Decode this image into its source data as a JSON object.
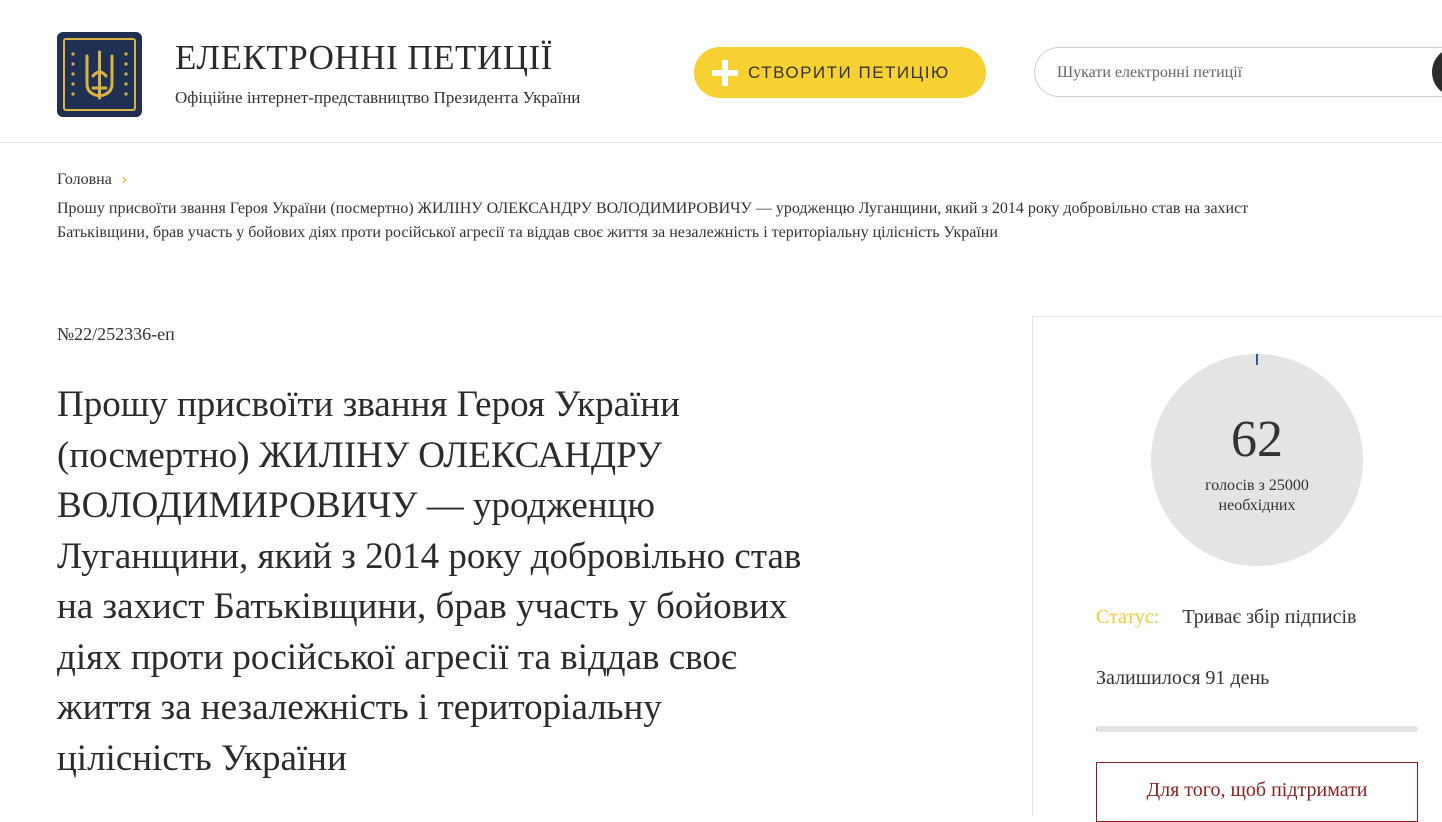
{
  "header": {
    "title": "ЕЛЕКТРОННІ ПЕТИЦІЇ",
    "subtitle": "Офіційне інтернет-представництво Президента України",
    "create_button": "СТВОРИТИ ПЕТИЦІЮ",
    "search_placeholder": "Шукати електронні петиції"
  },
  "colors": {
    "accent_yellow": "#f7d032",
    "logo_navy": "#1f3052",
    "support_red": "#8b1e1e"
  },
  "breadcrumb": {
    "home": "Головна",
    "current_line1": "Прошу присвоїти звання Героя України (посмертно) ЖИЛІНУ ОЛЕКСАНДРУ ВОЛОДИМИРОВИЧУ — уродженцю Луганщини, який з 2014 року добровільно став на захист",
    "current_line2": "Батьківщини, брав участь у бойових діях проти російської агресії та віддав своє життя за незалежність і територіальну цілісність України"
  },
  "petition": {
    "number": "№22/252336-еп",
    "title_lines": [
      "Прошу присвоїти звання Героя України",
      "(посмертно) ЖИЛІНУ ОЛЕКСАНДРУ",
      "ВОЛОДИМИРОВИЧУ — уродженцю",
      "Луганщини, який з 2014 року добровільно став",
      "на захист Батьківщини, брав участь у бойових",
      "діях проти російської агресії та віддав своє",
      "життя за незалежність і територіальну",
      "цілісність України"
    ]
  },
  "sidebar": {
    "votes": "62",
    "votes_label_line1": "голосів з 25000",
    "votes_label_line2": "необхідних",
    "status_label": "Статус:",
    "status_value": "Триває збір підписів",
    "remaining": "Залишилося 91 день",
    "progress_fraction": 0.00248,
    "support_text": "Для того, щоб підтримати"
  }
}
